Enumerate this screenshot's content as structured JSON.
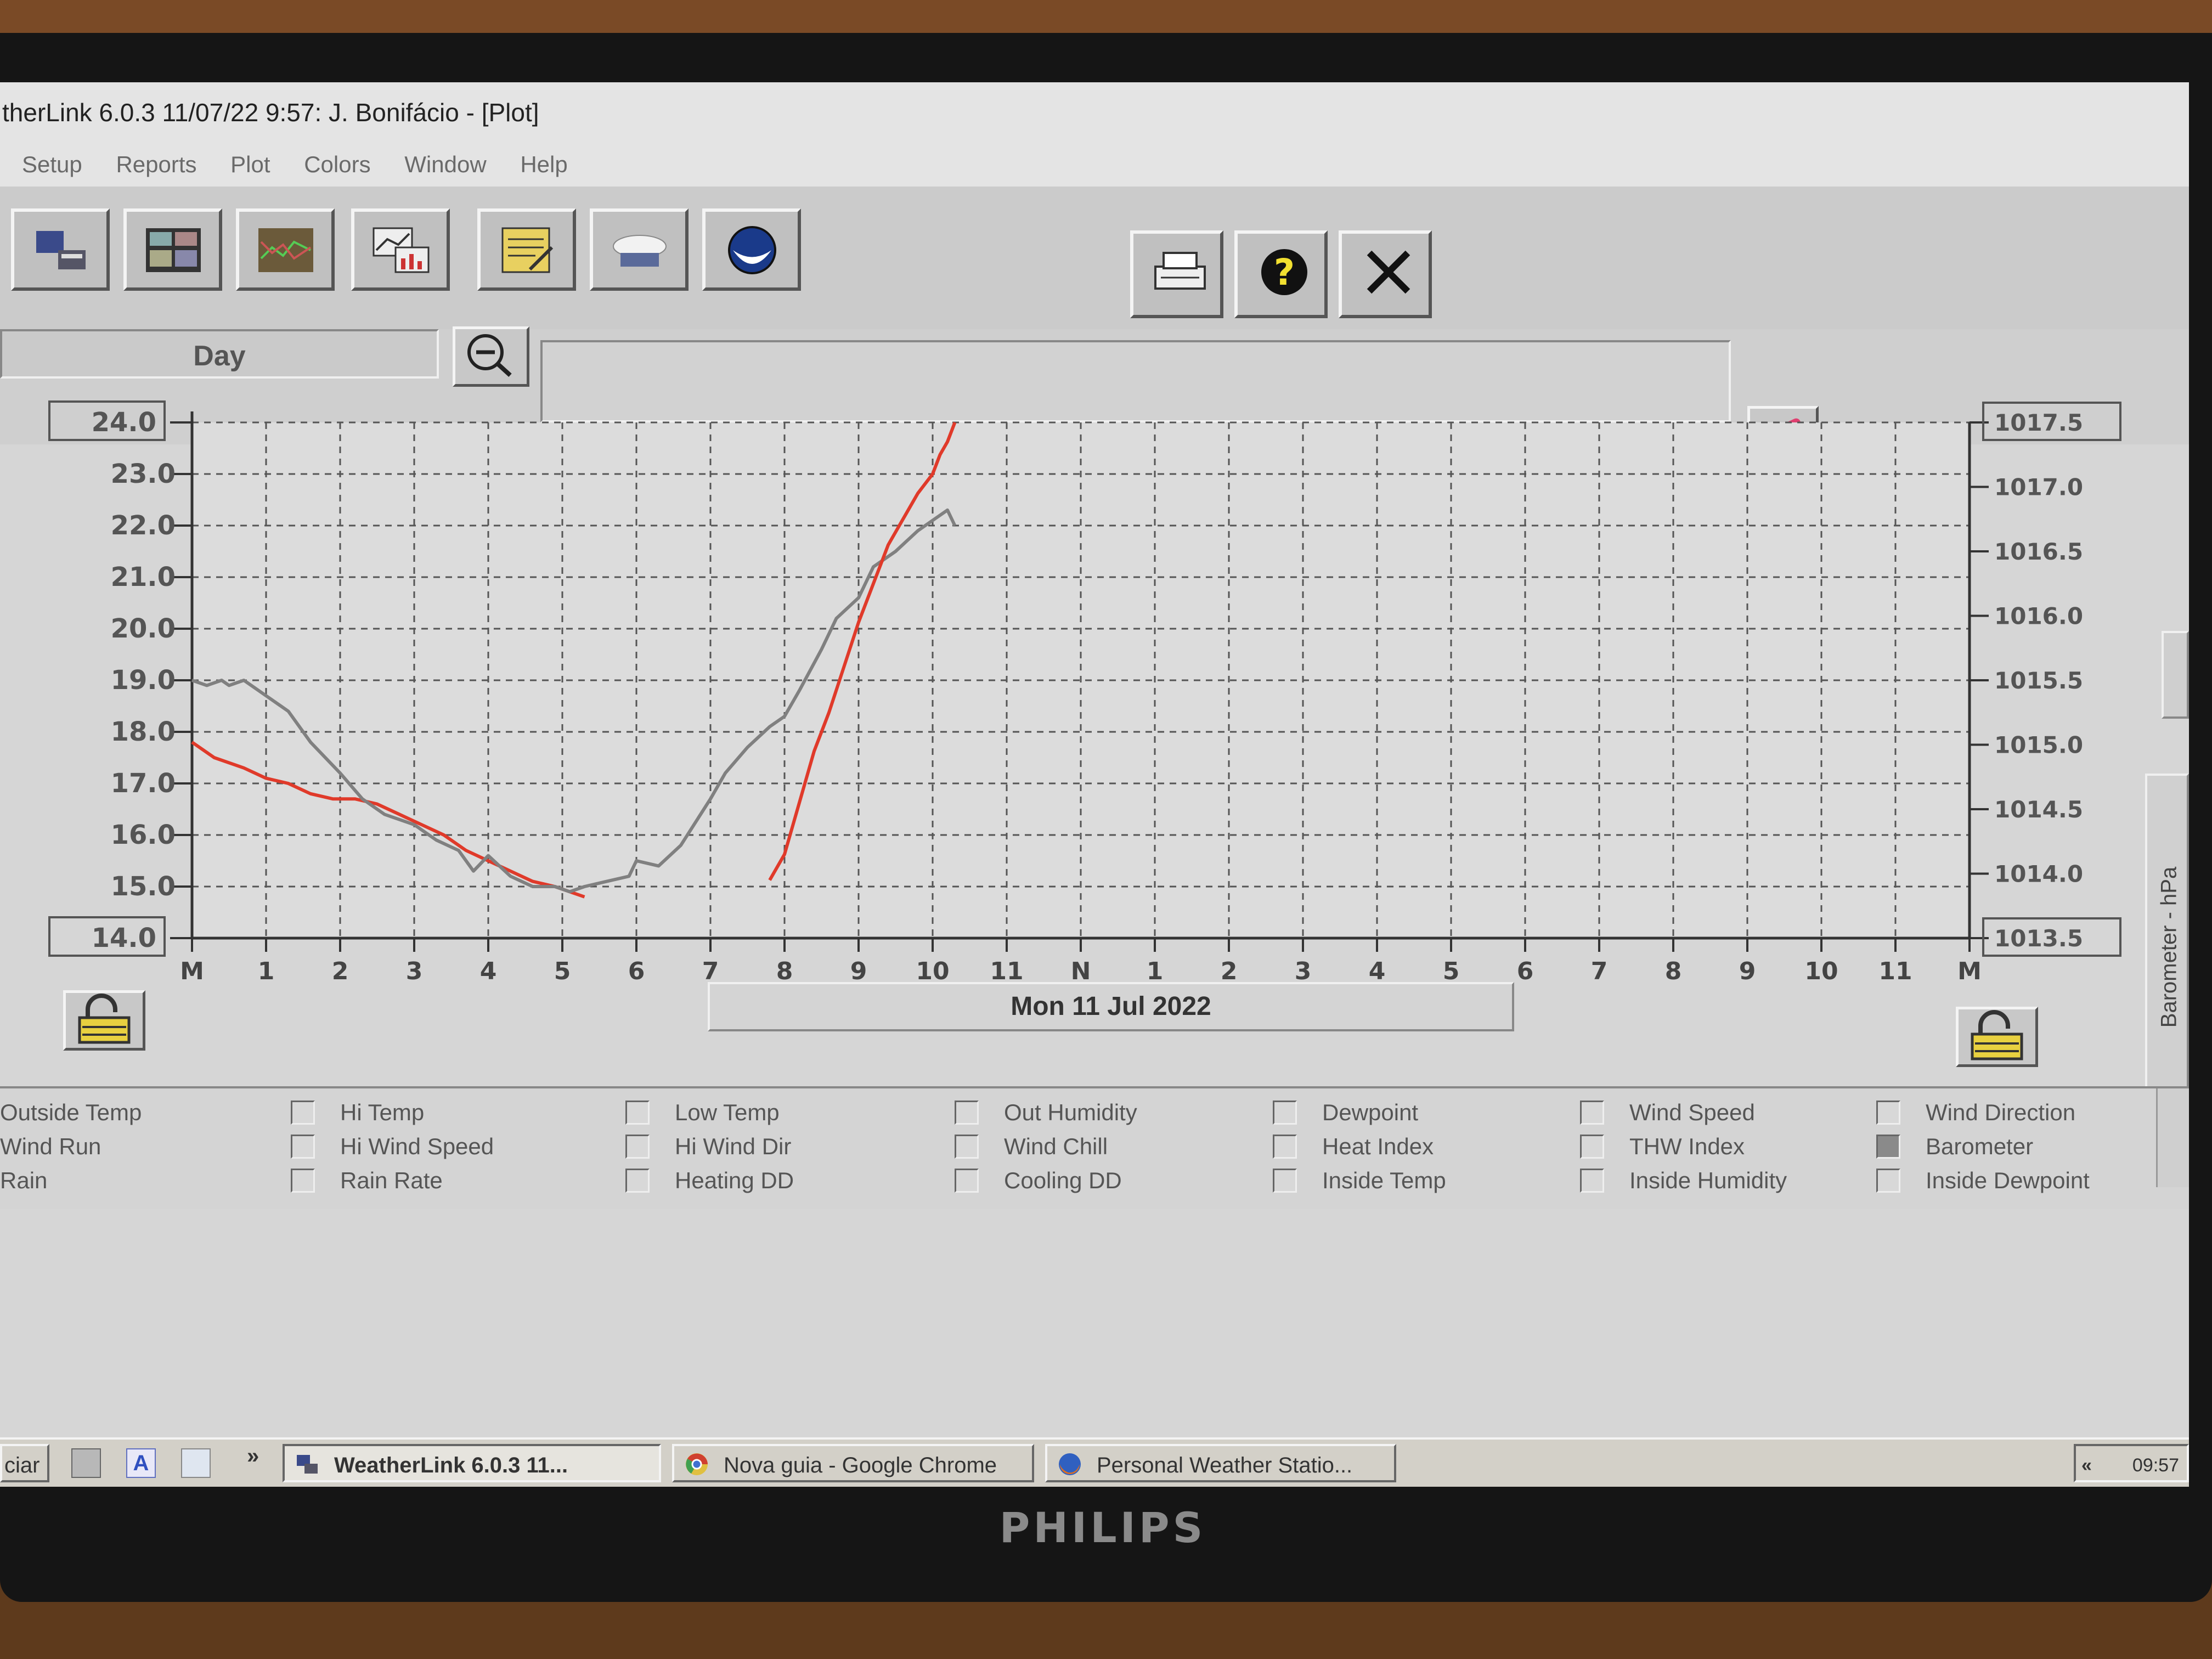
{
  "window": {
    "title": "therLink 6.0.3  11/07/22   9:57: J. Bonifácio - [Plot]"
  },
  "menu": [
    "Setup",
    "Reports",
    "Plot",
    "Colors",
    "Window",
    "Help"
  ],
  "toolbar_icons": [
    "station-icon",
    "bulletin-icon",
    "strip-chart-icon",
    "plot-icon",
    "notes-icon",
    "weather-icon",
    "noaa-icon"
  ],
  "toolbar_right_icons": [
    "print-icon",
    "help-icon",
    "close-icon"
  ],
  "plot": {
    "range_label": "Day",
    "date_label": "Mon 11 Jul 2022"
  },
  "chart_data": {
    "type": "line",
    "x_ticks": [
      "M",
      "1",
      "2",
      "3",
      "4",
      "5",
      "6",
      "7",
      "8",
      "9",
      "10",
      "11",
      "N",
      "1",
      "2",
      "3",
      "4",
      "5",
      "6",
      "7",
      "8",
      "9",
      "10",
      "11",
      "M"
    ],
    "y_left_ticks": [
      "24.0",
      "23.0",
      "22.0",
      "21.0",
      "20.0",
      "19.0",
      "18.0",
      "17.0",
      "16.0",
      "15.0",
      "14.0"
    ],
    "y_left_range": [
      14.0,
      24.0
    ],
    "y_right_ticks": [
      "1017.5",
      "1017.0",
      "1016.5",
      "1016.0",
      "1015.5",
      "1015.0",
      "1014.5",
      "1014.0",
      "1013.5"
    ],
    "y_right_range": [
      1013.5,
      1017.5
    ],
    "y_right_label": "Barometer - hPa",
    "grid": true,
    "series": [
      {
        "color": "#808080",
        "axis": "left",
        "x": [
          0,
          0.2,
          0.4,
          0.5,
          0.7,
          1.0,
          1.3,
          1.6,
          2.0,
          2.3,
          2.6,
          3.0,
          3.3,
          3.6,
          3.8,
          4.0,
          4.3,
          4.6,
          4.9,
          5.1,
          5.3,
          5.6,
          5.9,
          6.0,
          6.3,
          6.6,
          7.0,
          7.2,
          7.5,
          7.8,
          8.0,
          8.2,
          8.5,
          8.7,
          9.0,
          9.2,
          9.5,
          9.8,
          10.0,
          10.2,
          10.3
        ],
        "y": [
          19.0,
          18.9,
          19.0,
          18.9,
          19.0,
          18.7,
          18.4,
          17.8,
          17.2,
          16.7,
          16.4,
          16.2,
          15.9,
          15.7,
          15.3,
          15.6,
          15.2,
          15.0,
          15.0,
          14.9,
          15.0,
          15.1,
          15.2,
          15.5,
          15.4,
          15.8,
          16.7,
          17.2,
          17.7,
          18.1,
          18.3,
          18.8,
          19.6,
          20.2,
          20.6,
          21.2,
          21.5,
          21.9,
          22.1,
          22.3,
          22.0
        ]
      },
      {
        "color": "#e03a2a",
        "axis": "right",
        "x": [
          7.8,
          8.0,
          8.2,
          8.4,
          8.6,
          8.8,
          9.0,
          9.2,
          9.4,
          9.6,
          9.8,
          10.0,
          10.1,
          10.2,
          10.3
        ],
        "y": [
          1013.95,
          1014.15,
          1014.55,
          1014.95,
          1015.25,
          1015.6,
          1015.95,
          1016.25,
          1016.55,
          1016.75,
          1016.95,
          1017.1,
          1017.25,
          1017.35,
          1017.5
        ]
      }
    ],
    "series_left_from_midnight": {
      "color": "#e03a2a",
      "axis": "left",
      "x": [
        0,
        0.3,
        0.7,
        1.0,
        1.3,
        1.6,
        1.9,
        2.2,
        2.5,
        2.8,
        3.1,
        3.4,
        3.7,
        4.0,
        4.3,
        4.6,
        4.9,
        5.1,
        5.3
      ],
      "y": [
        17.8,
        17.5,
        17.3,
        17.1,
        17.0,
        16.8,
        16.7,
        16.7,
        16.6,
        16.4,
        16.2,
        16.0,
        15.7,
        15.5,
        15.3,
        15.1,
        15.0,
        14.9,
        14.8
      ]
    }
  },
  "fields": [
    [
      {
        "label": "Outside Temp",
        "checked": true
      },
      {
        "label": "Wind Run",
        "checked": false
      },
      {
        "label": "Rain",
        "checked": false
      }
    ],
    [
      {
        "label": "Hi Temp",
        "checked": false
      },
      {
        "label": "Hi Wind Speed",
        "checked": false
      },
      {
        "label": "Rain Rate",
        "checked": false
      }
    ],
    [
      {
        "label": "Low Temp",
        "checked": false
      },
      {
        "label": "Hi Wind Dir",
        "checked": false
      },
      {
        "label": "Heating DD",
        "checked": false
      }
    ],
    [
      {
        "label": "Out Humidity",
        "checked": false
      },
      {
        "label": "Wind Chill",
        "checked": false
      },
      {
        "label": "Cooling DD",
        "checked": false
      }
    ],
    [
      {
        "label": "Dewpoint",
        "checked": false
      },
      {
        "label": "Heat Index",
        "checked": false
      },
      {
        "label": "Inside Temp",
        "checked": false
      }
    ],
    [
      {
        "label": "Wind Speed",
        "checked": false
      },
      {
        "label": "THW Index",
        "checked": false
      },
      {
        "label": "Inside Humidity",
        "checked": false
      }
    ],
    [
      {
        "label": "Wind Direction",
        "checked": false
      },
      {
        "label": "Barometer",
        "checked": true
      },
      {
        "label": "Inside Dewpoint",
        "checked": false
      }
    ]
  ],
  "taskbar": {
    "start": "ciar",
    "tasks": [
      {
        "label": "WeatherLink 6.0.3  11...",
        "icon": "weatherlink-icon",
        "active": true
      },
      {
        "label": "Nova guia - Google Chrome",
        "icon": "chrome-icon",
        "active": false
      },
      {
        "label": "Personal Weather Statio...",
        "icon": "firefox-icon",
        "active": false
      }
    ],
    "clock": "09:57"
  },
  "monitor_brand": "PHILIPS"
}
